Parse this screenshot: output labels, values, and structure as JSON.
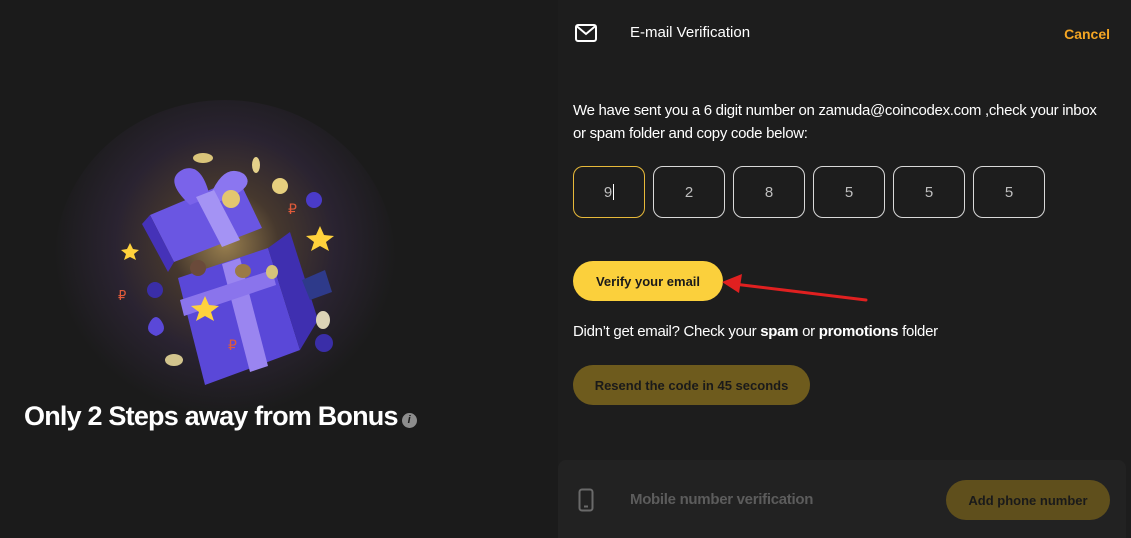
{
  "promo": {
    "headline": "Only 2 Steps away from Bonus",
    "info_icon": "i"
  },
  "header": {
    "icon": "mail-icon",
    "title": "E-mail Verification",
    "cancel_label": "Cancel"
  },
  "instructions": "We have sent you a 6 digit number on zamuda@coincodex.com ,check your inbox or spam folder and copy code below:",
  "code_digits": [
    "9",
    "2",
    "8",
    "5",
    "5",
    "5"
  ],
  "verify_button": "Verify your email",
  "help": {
    "prefix": "Didn’t get email? Check your ",
    "spam": "spam",
    "or": " or ",
    "promotions": "promotions",
    "suffix": " folder"
  },
  "resend_button": "Resend the code in 45 seconds",
  "mobile": {
    "icon": "phone-icon",
    "title": "Mobile number verification",
    "button": "Add phone number"
  },
  "colors": {
    "accent": "#fbd03c",
    "cancel": "#f5a623",
    "annotation_arrow": "#e02020"
  }
}
